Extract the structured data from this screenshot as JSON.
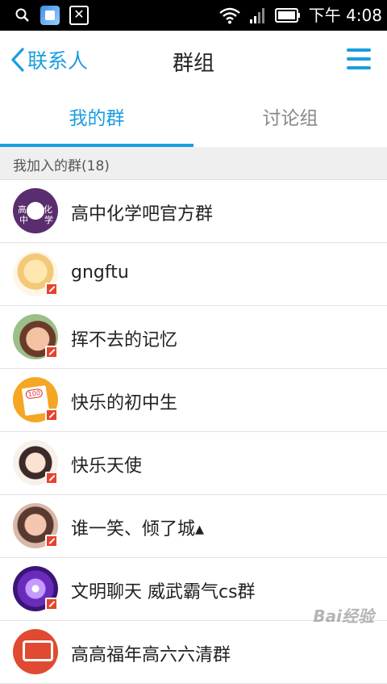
{
  "status_bar": {
    "time": "下午 4:08",
    "icons": [
      "search-icon",
      "app-icon",
      "close-box-icon",
      "wifi-icon",
      "signal-icon",
      "battery-icon"
    ]
  },
  "nav": {
    "back_label": "联系人",
    "title": "群组",
    "accent_color": "#1a9de0"
  },
  "tabs": [
    {
      "label": "我的群",
      "active": true
    },
    {
      "label": "讨论组",
      "active": false
    }
  ],
  "section": {
    "label": "我加入的群(18)"
  },
  "groups": [
    {
      "name": "高中化学吧官方群",
      "avatar_text": [
        "高",
        "中",
        "化",
        "学"
      ]
    },
    {
      "name": "gngftu"
    },
    {
      "name": "挥不去的记忆"
    },
    {
      "name": "快乐的初中生"
    },
    {
      "name": "快乐天使"
    },
    {
      "name": "谁一笑、倾了城▴"
    },
    {
      "name": "文明聊天 威武霸气cs群"
    },
    {
      "name": "高高福年高六六清群"
    }
  ],
  "watermark": "Bai经验"
}
